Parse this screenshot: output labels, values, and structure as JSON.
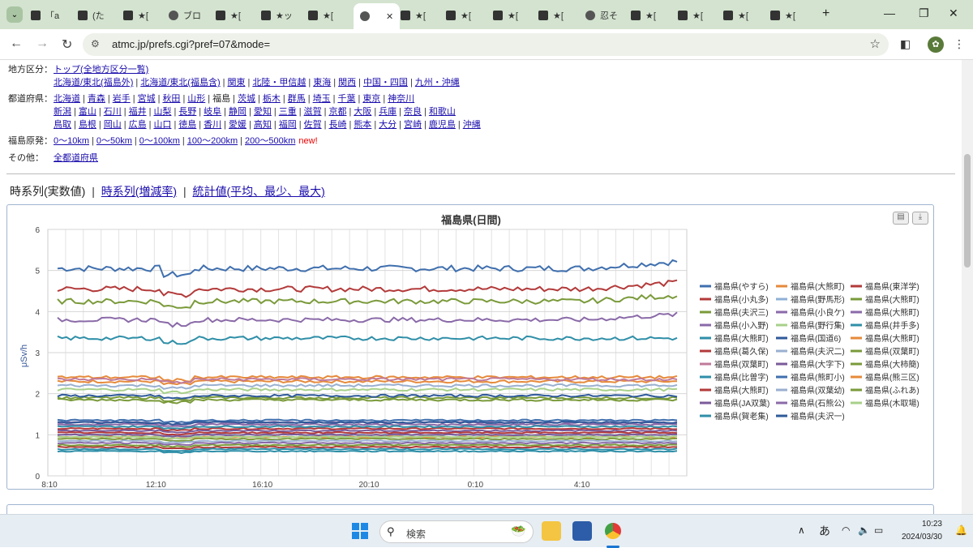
{
  "browser": {
    "tabs": [
      {
        "label": "「a",
        "favicon": "page-icon"
      },
      {
        "label": "(た",
        "favicon": "page-icon"
      },
      {
        "label": "★[",
        "favicon": "page-icon"
      },
      {
        "label": "ブロ",
        "favicon": "info-icon"
      },
      {
        "label": "★[",
        "favicon": "page-icon"
      },
      {
        "label": "★ッ",
        "favicon": "page-icon"
      },
      {
        "label": "★[",
        "favicon": "page-icon"
      },
      {
        "label": "",
        "favicon": "globe-icon",
        "active": true
      },
      {
        "label": "★[",
        "favicon": "page-icon"
      },
      {
        "label": "★[",
        "favicon": "page-icon"
      },
      {
        "label": "★[",
        "favicon": "page-icon"
      },
      {
        "label": "★[",
        "favicon": "page-icon"
      },
      {
        "label": "忍そ",
        "favicon": "globe-icon"
      },
      {
        "label": "★[",
        "favicon": "page-icon"
      },
      {
        "label": "★[",
        "favicon": "page-icon"
      },
      {
        "label": "★[",
        "favicon": "page-icon"
      },
      {
        "label": "★[",
        "favicon": "page-icon"
      }
    ],
    "url": "atmc.jp/prefs.cgi?pref=07&mode="
  },
  "nav": {
    "region_label": "地方区分：",
    "region_top": "トップ(全地方区分一覧)",
    "regions": [
      "北海道/東北(福島外)",
      "北海道/東北(福島含)",
      "関東",
      "北陸・甲信越",
      "東海",
      "関西",
      "中国・四国",
      "九州・沖縄"
    ],
    "pref_label": "都道府県：",
    "prefs_row1": [
      "北海道",
      "青森",
      "岩手",
      "宮城",
      "秋田",
      "山形",
      "福島",
      "茨城",
      "栃木",
      "群馬",
      "埼玉",
      "千葉",
      "東京",
      "神奈川"
    ],
    "prefs_row2": [
      "新潟",
      "富山",
      "石川",
      "福井",
      "山梨",
      "長野",
      "岐阜",
      "静岡",
      "愛知",
      "三重",
      "滋賀",
      "京都",
      "大阪",
      "兵庫",
      "奈良",
      "和歌山"
    ],
    "prefs_row3": [
      "鳥取",
      "島根",
      "岡山",
      "広島",
      "山口",
      "徳島",
      "香川",
      "愛媛",
      "高知",
      "福岡",
      "佐賀",
      "長崎",
      "熊本",
      "大分",
      "宮崎",
      "鹿児島",
      "沖縄"
    ],
    "current_pref": "福島",
    "genpatsu_label": "福島原発：",
    "genpatsu": [
      "0〜10km",
      "0〜50km",
      "0〜100km",
      "100〜200km",
      "200〜500km"
    ],
    "new_tag": "new!",
    "other_label": "その他：",
    "other": "全都道府県"
  },
  "view_links": {
    "current": "時系列(実数値)",
    "links": [
      "時系列(増減率)",
      "統計値(平均、最少、最大)"
    ]
  },
  "chart_data": {
    "type": "line",
    "title": "福島県(日間)",
    "ylabel": "μSv/h",
    "xlabel": "",
    "ylim": [
      0,
      6
    ],
    "yticks": [
      "0",
      "1",
      "2",
      "3",
      "4",
      "5",
      "6"
    ],
    "xticks": [
      "8:10",
      "12:10",
      "16:10",
      "20:10",
      "0:10",
      "4:10"
    ],
    "grid": true,
    "legend_position": "right",
    "series": [
      {
        "name": "福島県(やすら)",
        "color": "#3f6fae",
        "level": 5.05
      },
      {
        "name": "福島県(大熊町)",
        "color": "#e68a3a",
        "level": 2.3
      },
      {
        "name": "福島県(東洋学)",
        "color": "#b33a3a",
        "level": 4.55
      },
      {
        "name": "福島県(小丸多)",
        "color": "#b33a3a",
        "level": 1.15
      },
      {
        "name": "福島県(野馬形)",
        "color": "#8fb0d6",
        "level": 1.0
      },
      {
        "name": "福島県(大熊町)",
        "color": "#7a9a3a",
        "level": 4.25
      },
      {
        "name": "福島県(夫沢三)",
        "color": "#7a9a3a",
        "level": 1.9
      },
      {
        "name": "福島県(小良ケ)",
        "color": "#8a6aa8",
        "level": 1.3
      },
      {
        "name": "福島県(大熊町)",
        "color": "#8a6aa8",
        "level": 3.8
      },
      {
        "name": "福島県(小入野)",
        "color": "#8a6aa8",
        "level": 1.25
      },
      {
        "name": "福島県(野行集)",
        "color": "#a8d08a",
        "level": 2.1
      },
      {
        "name": "福島県(井手多)",
        "color": "#2f8fa8",
        "level": 3.35
      },
      {
        "name": "福島県(大熊町)",
        "color": "#2f8fa8",
        "level": 1.2
      },
      {
        "name": "福島県(国道6)",
        "color": "#2f5a9a",
        "level": 1.95
      },
      {
        "name": "福島県(大熊町)",
        "color": "#e68a3a",
        "level": 2.4
      },
      {
        "name": "福島県(葛久保)",
        "color": "#b33a3a",
        "level": 0.7
      },
      {
        "name": "福島県(夫沢二)",
        "color": "#9ab0d0",
        "level": 2.2
      },
      {
        "name": "福島県(双葉町)",
        "color": "#7a9a3a",
        "level": 1.85
      },
      {
        "name": "福島県(双葉町)",
        "color": "#c07a9a",
        "level": 2.35
      },
      {
        "name": "福島県(大字下)",
        "color": "#7a5a9a",
        "level": 1.1
      },
      {
        "name": "福島県(大柿簡)",
        "color": "#7a9a3a",
        "level": 0.9
      },
      {
        "name": "福島県(比曽字)",
        "color": "#2f8fa8",
        "level": 0.6
      },
      {
        "name": "福島県(熊町小)",
        "color": "#3f6fae",
        "level": 1.35
      },
      {
        "name": "福島県(熊三区)",
        "color": "#e68a3a",
        "level": 0.95
      },
      {
        "name": "福島県(大熊町)",
        "color": "#b33a3a",
        "level": 1.05
      },
      {
        "name": "福島県(双葉幼)",
        "color": "#9ab0d0",
        "level": 0.85
      },
      {
        "name": "福島県(ふれあ)",
        "color": "#7a9a3a",
        "level": 0.75
      },
      {
        "name": "福島県(JA双葉)",
        "color": "#7a5a9a",
        "level": 1.0
      },
      {
        "name": "福島県(石熊公)",
        "color": "#8a6aa8",
        "level": 0.8
      },
      {
        "name": "福島県(木取場)",
        "color": "#a8d08a",
        "level": 0.95
      },
      {
        "name": "福島県(賀老集)",
        "color": "#2f8fa8",
        "level": 0.65
      },
      {
        "name": "福島県(夫沢一)",
        "color": "#2f5a9a",
        "level": 1.3
      }
    ]
  },
  "taskbar": {
    "search_placeholder": "検索",
    "ime": "あ",
    "time": "10:23",
    "date": "2024/03/30"
  }
}
